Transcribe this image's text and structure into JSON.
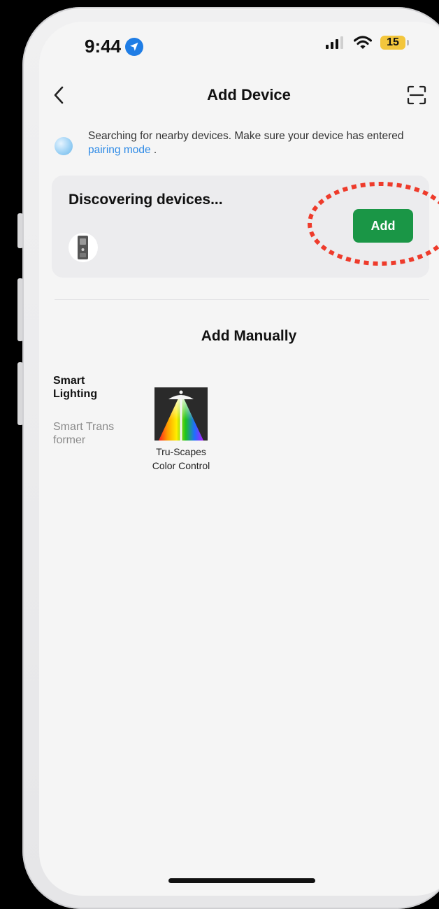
{
  "status_bar": {
    "time": "9:44",
    "battery_level": "15"
  },
  "nav": {
    "title": "Add Device",
    "back_icon": "chevron-left-icon",
    "scan_icon": "scan-icon"
  },
  "info": {
    "text_before": "Searching for nearby devices. Make sure your device has entered ",
    "link": "pairing mode",
    "text_after": " ."
  },
  "discover": {
    "title": "Discovering devices...",
    "add_label": "Add"
  },
  "manual": {
    "title": "Add Manually",
    "categories": [
      {
        "label": "Smart Lighting"
      },
      {
        "label": "Smart Transformer"
      }
    ],
    "products": [
      {
        "line1": "Tru-Scapes",
        "line2": "Color Control"
      }
    ]
  },
  "colors": {
    "accent_green": "#1a9646",
    "link_blue": "#2d8ae6",
    "highlight_red": "#ee3b2b",
    "battery_yellow": "#f3c63c"
  }
}
